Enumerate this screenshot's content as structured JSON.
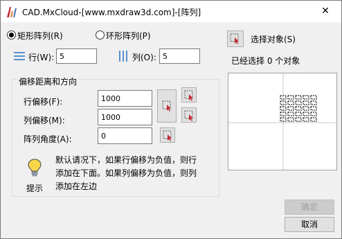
{
  "window": {
    "title": "CAD.MxCloud-[www.mxdraw3d.com]-[阵列]",
    "close_glyph": "✕"
  },
  "array_type": {
    "rect_label": "矩形阵列(R)",
    "polar_label": "环形阵列(P)",
    "selected": "rect"
  },
  "rows": {
    "label": "行(W):",
    "value": "5"
  },
  "cols": {
    "label": "列(O):",
    "value": "5"
  },
  "select_objects": {
    "label": "选择对象(S)",
    "status": "已经选择 0 个对象"
  },
  "offset_group": {
    "title": "偏移距离和方向",
    "row_offset": {
      "label": "行偏移(F):",
      "value": "1000"
    },
    "col_offset": {
      "label": "列偏移(M):",
      "value": "1000"
    },
    "angle": {
      "label": "阵列角度(A):",
      "value": "0"
    }
  },
  "hint": {
    "label": "提示",
    "text": "默认请况下，如果行偏移为负值，则行添加在下面。如果列偏移为负值，则列添加在左边"
  },
  "buttons": {
    "ok": "确定",
    "cancel": "取消",
    "ok_enabled": false
  },
  "colors": {
    "accent_red": "#c0282d",
    "title_bg": "#ffffff",
    "dialog_bg": "#f0f0f0"
  },
  "preview": {
    "rows": 5,
    "cols": 5
  }
}
